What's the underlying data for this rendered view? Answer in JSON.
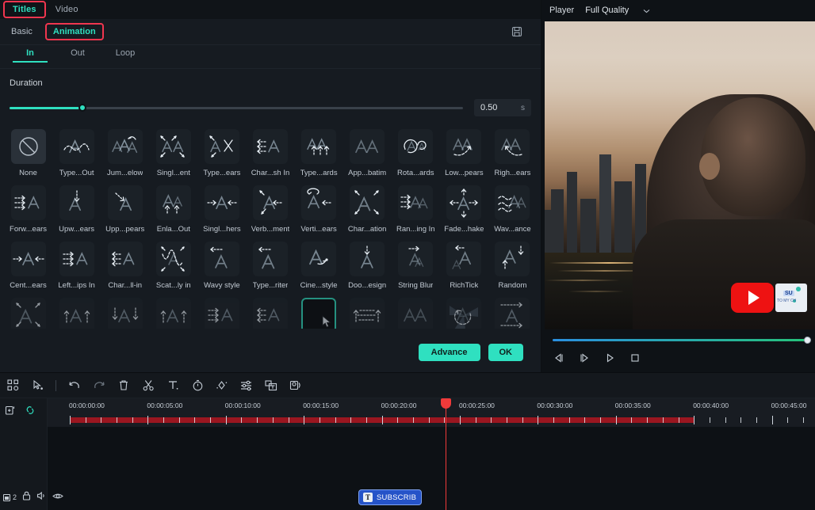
{
  "top_tabs": [
    {
      "label": "Titles",
      "active": true,
      "highlighted": true
    },
    {
      "label": "Video",
      "active": false,
      "highlighted": false
    }
  ],
  "sub_tabs": [
    {
      "label": "Basic",
      "active": false,
      "highlighted": false
    },
    {
      "label": "Animation",
      "active": true,
      "highlighted": true
    }
  ],
  "save_icon": "save-disk-icon",
  "segment_tabs": [
    {
      "label": "In",
      "active": true
    },
    {
      "label": "Out",
      "active": false
    },
    {
      "label": "Loop",
      "active": false
    }
  ],
  "duration": {
    "label": "Duration",
    "value": "0.50",
    "unit": "s",
    "fill_percent": 16
  },
  "presets": [
    {
      "label": "None",
      "icon": "none-circle-slash-icon",
      "kind": "none"
    },
    {
      "label": "Type...Out",
      "icon": "typewriter-wave-out-icon",
      "kind": "wave-out"
    },
    {
      "label": "Jum...elow",
      "icon": "jump-below-icon",
      "kind": "jump"
    },
    {
      "label": "Singl...ent",
      "icon": "single-scatter-icon",
      "kind": "scatter4"
    },
    {
      "label": "Type...ears",
      "icon": "type-cross-appears-icon",
      "kind": "crossx"
    },
    {
      "label": "Char...sh In",
      "icon": "character-dash-in-icon",
      "kind": "leftarrows"
    },
    {
      "label": "Type...ards",
      "icon": "type-upwards-icon",
      "kind": "uparrows"
    },
    {
      "label": "App...batim",
      "icon": "appear-verbatim-icon",
      "kind": "plain"
    },
    {
      "label": "Rota...ards",
      "icon": "rotate-upwards-icon",
      "kind": "rotate"
    },
    {
      "label": "Low...pears",
      "icon": "lower-appears-icon",
      "kind": "swoopright"
    },
    {
      "label": "Righ...ears",
      "icon": "right-appears-icon",
      "kind": "swoopleft"
    },
    {
      "label": "Forw...ears",
      "icon": "forward-appears-icon",
      "kind": "rightarrows"
    },
    {
      "label": "Upw...ears",
      "icon": "upward-appears-icon",
      "kind": "downarrow"
    },
    {
      "label": "Upp...pears",
      "icon": "upper-appears-icon",
      "kind": "diagarrow"
    },
    {
      "label": "Enla...Out",
      "icon": "enlarge-out-icon",
      "kind": "twoup"
    },
    {
      "label": "Singl...hers",
      "icon": "single-gathers-icon",
      "kind": "inward"
    },
    {
      "label": "Verb...ment",
      "icon": "verbatim-movement-icon",
      "kind": "diagpair"
    },
    {
      "label": "Verti...ears",
      "icon": "vertical-appears-icon",
      "kind": "spinleft"
    },
    {
      "label": "Char...ation",
      "icon": "character-rotation-icon",
      "kind": "corners4"
    },
    {
      "label": "Ran...ing In",
      "icon": "random-moving-in-icon",
      "kind": "dashright"
    },
    {
      "label": "Fade...hake",
      "icon": "fade-shake-icon",
      "kind": "burst"
    },
    {
      "label": "Wav...ance",
      "icon": "wave-entrance-icon",
      "kind": "wavelines"
    },
    {
      "label": "Cent...ears",
      "icon": "center-appears-icon",
      "kind": "centerin"
    },
    {
      "label": "Left...ips In",
      "icon": "left-flips-in-icon",
      "kind": "rightarrows"
    },
    {
      "label": "Char...ll-in",
      "icon": "character-roll-in-icon",
      "kind": "leftarrows"
    },
    {
      "label": "Scat...ly in",
      "icon": "scatter-randomly-in-icon",
      "kind": "scatterwave"
    },
    {
      "label": "Wavy style",
      "icon": "wavy-style-icon",
      "kind": "dashleft"
    },
    {
      "label": "Type...riter",
      "icon": "typewriter-icon",
      "kind": "dashleft2"
    },
    {
      "label": "Cine...style",
      "icon": "cinematic-style-icon",
      "kind": "cine"
    },
    {
      "label": "Doo...esign",
      "icon": "doodle-design-icon",
      "kind": "downpin"
    },
    {
      "label": "String Blur",
      "icon": "string-blur-icon",
      "kind": "dashrightsm"
    },
    {
      "label": "RichTick",
      "icon": "rich-tick-icon",
      "kind": "dashleftsm"
    },
    {
      "label": "Random",
      "icon": "random-icon",
      "kind": "randomarrows"
    },
    {
      "label": "",
      "icon": "corners-in-icon",
      "kind": "corners4"
    },
    {
      "label": "",
      "icon": "up-two-arrows-icon",
      "kind": "uptwo"
    },
    {
      "label": "",
      "icon": "down-two-arrows-icon",
      "kind": "downtwo"
    },
    {
      "label": "",
      "icon": "up-dashed-arrows-icon",
      "kind": "updashed"
    },
    {
      "label": "",
      "icon": "left-enters-icon",
      "kind": "rightarrows"
    },
    {
      "label": "",
      "icon": "right-enters-icon",
      "kind": "leftarrows"
    },
    {
      "label": "",
      "icon": "cursor-selected-icon",
      "kind": "cursor",
      "selected": true
    },
    {
      "label": "",
      "icon": "reveal-icon",
      "kind": "revealup"
    },
    {
      "label": "",
      "icon": "blur-in-icon",
      "kind": "plain"
    },
    {
      "label": "",
      "icon": "pinwheel-icon",
      "kind": "pinwheel"
    },
    {
      "label": "",
      "icon": "slide-across-icon",
      "kind": "slideacross"
    }
  ],
  "actions": {
    "advance_label": "Advance",
    "ok_label": "OK"
  },
  "player": {
    "title": "Player",
    "quality": "Full Quality",
    "quality_caret": "chevron-down-icon",
    "controls": [
      {
        "name": "prev-frame-button",
        "icon": "step-back-icon"
      },
      {
        "name": "next-frame-button",
        "icon": "step-forward-icon"
      },
      {
        "name": "play-button",
        "icon": "play-icon"
      },
      {
        "name": "stop-button",
        "icon": "stop-icon"
      }
    ],
    "progress_percent": 100
  },
  "timeline": {
    "toolbar": [
      {
        "name": "grid-tool",
        "icon": "grid-icon"
      },
      {
        "name": "select-tool",
        "icon": "cursor-select-icon"
      },
      {
        "name": "undo-button",
        "icon": "undo-icon"
      },
      {
        "name": "redo-button",
        "icon": "redo-icon"
      },
      {
        "name": "delete-button",
        "icon": "trash-icon"
      },
      {
        "name": "split-button",
        "icon": "scissors-icon"
      },
      {
        "name": "text-button",
        "icon": "text-t-icon"
      },
      {
        "name": "speed-button",
        "icon": "stopwatch-icon"
      },
      {
        "name": "keyframe-button",
        "icon": "diamond-icon"
      },
      {
        "name": "adjust-button",
        "icon": "sliders-icon"
      },
      {
        "name": "title-button",
        "icon": "title-box-icon"
      },
      {
        "name": "audio-detach-button",
        "icon": "audio-stack-icon"
      }
    ],
    "left_icons": [
      {
        "name": "add-media-button",
        "icon": "add-box-icon"
      },
      {
        "name": "link-toggle",
        "icon": "link-icon"
      }
    ],
    "ruler_labels": [
      "00:00:00:00",
      "00:00:05:00",
      "00:00:10:00",
      "00:00:15:00",
      "00:00:20:00",
      "00:00:25:00",
      "00:00:30:00",
      "00:00:35:00",
      "00:00:40:00",
      "00:00:45:00"
    ],
    "playhead_time": "00:00:23:00",
    "track_header": {
      "layer_count": "2",
      "lock_icon": "lock-icon",
      "mute_icon": "speaker-icon",
      "visibility_icon": "eye-icon"
    },
    "clip": {
      "label": "SUBSCRIB",
      "type_icon": "text-clip-icon"
    }
  },
  "colors": {
    "accent": "#2fe0c0",
    "highlight": "#f0364f",
    "clip": "#2553c8",
    "ruler": "#9a1620",
    "playhead": "#f03a3a"
  }
}
